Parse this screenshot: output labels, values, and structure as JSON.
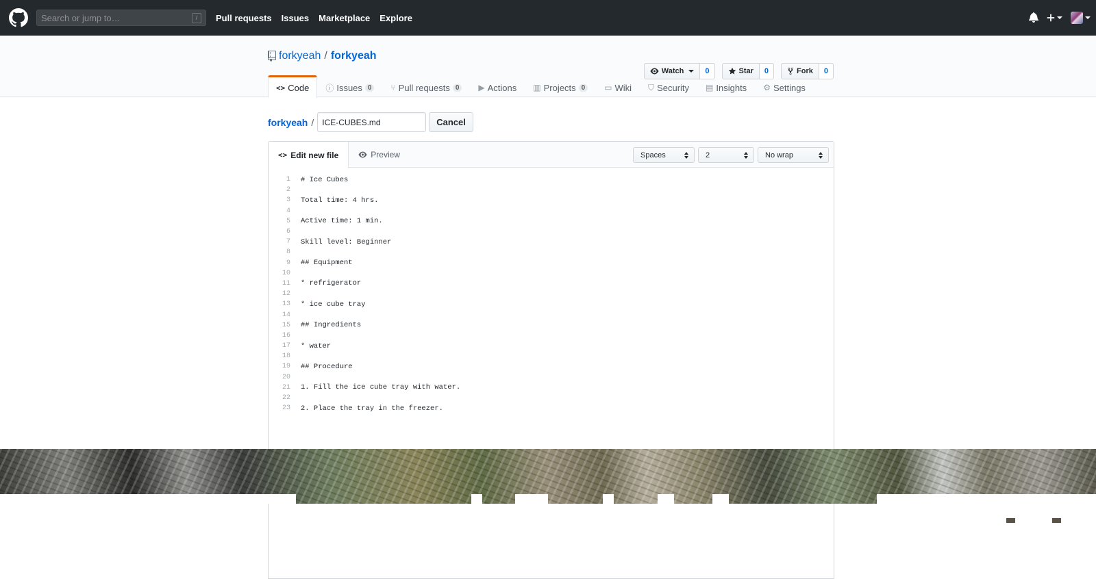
{
  "header": {
    "search_placeholder": "Search or jump to…",
    "search_shortcut": "/",
    "nav": [
      "Pull requests",
      "Issues",
      "Marketplace",
      "Explore"
    ]
  },
  "repo": {
    "owner": "forkyeah",
    "separator": "/",
    "name": "forkyeah",
    "watch_label": "Watch",
    "watch_count": "0",
    "star_label": "Star",
    "star_count": "0",
    "fork_label": "Fork",
    "fork_count": "0"
  },
  "tabs": [
    {
      "label": "Code",
      "icon": "code-icon",
      "selected": true
    },
    {
      "label": "Issues",
      "icon": "issue-icon",
      "counter": "0"
    },
    {
      "label": "Pull requests",
      "icon": "pull-request-icon",
      "counter": "0"
    },
    {
      "label": "Actions",
      "icon": "play-icon"
    },
    {
      "label": "Projects",
      "icon": "project-icon",
      "counter": "0"
    },
    {
      "label": "Wiki",
      "icon": "book-icon"
    },
    {
      "label": "Security",
      "icon": "shield-icon"
    },
    {
      "label": "Insights",
      "icon": "graph-icon"
    },
    {
      "label": "Settings",
      "icon": "gear-icon"
    }
  ],
  "breadcrumb": {
    "root": "forkyeah",
    "separator": "/",
    "filename": "ICE-CUBES.md",
    "cancel_label": "Cancel"
  },
  "editor": {
    "tab_edit": "Edit new file",
    "tab_preview": "Preview",
    "indent_mode": "Spaces",
    "indent_size": "2",
    "wrap_mode": "No wrap",
    "lines": [
      "# Ice Cubes",
      "",
      "Total time: 4 hrs.",
      "",
      "Active time: 1 min.",
      "",
      "Skill level: Beginner",
      "",
      "## Equipment",
      "",
      "* refrigerator",
      "",
      "* ice cube tray",
      "",
      "## Ingredients",
      "",
      "* water",
      "",
      "## Procedure",
      "",
      "1. Fill the ice cube tray with water.",
      "",
      "2. Place the tray in the freezer."
    ]
  },
  "colors": {
    "header_bg": "#24292e",
    "link": "#0366d6",
    "tab_accent": "#e36209"
  }
}
